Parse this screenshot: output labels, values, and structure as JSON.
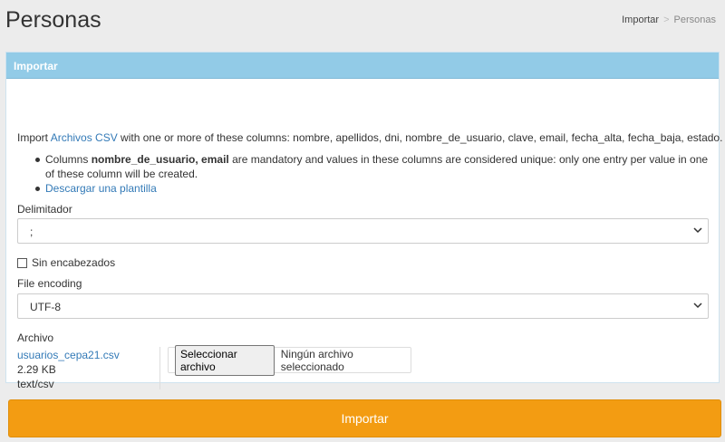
{
  "page": {
    "title": "Personas"
  },
  "breadcrumb": {
    "items": [
      "Importar",
      "Personas"
    ],
    "separator": ">"
  },
  "panel": {
    "heading": "Importar",
    "intro": {
      "prefix": "Import ",
      "link": "Archivos CSV",
      "suffix": " with one or more of these columns: nombre, apellidos, dni, nombre_de_usuario, clave, email, fecha_alta, fecha_baja, estado."
    },
    "notes": {
      "prefix": "Columns ",
      "bold": "nombre_de_usuario, email",
      "suffix": " are mandatory and values in these columns are considered unique: only one entry per value in one of these column will be created.",
      "template_link": "Descargar una plantilla"
    },
    "delimiter": {
      "label": "Delimitador",
      "value": ";"
    },
    "no_headers": {
      "label": "Sin encabezados",
      "checked": false
    },
    "encoding": {
      "label": "File encoding",
      "value": "UTF-8"
    },
    "file": {
      "label": "Archivo",
      "name": "usuarios_cepa21.csv",
      "size": "2.29 KB",
      "type": "text/csv",
      "button_label": "Seleccionar archivo",
      "status": "Ningún archivo seleccionado"
    }
  },
  "submit": {
    "label": "Importar"
  },
  "colors": {
    "panel_heading": "#92cbe7",
    "submit_button": "#f39c12",
    "link": "#337ab7"
  },
  "icons": {
    "select_arrow": "chevron-down-icon"
  }
}
